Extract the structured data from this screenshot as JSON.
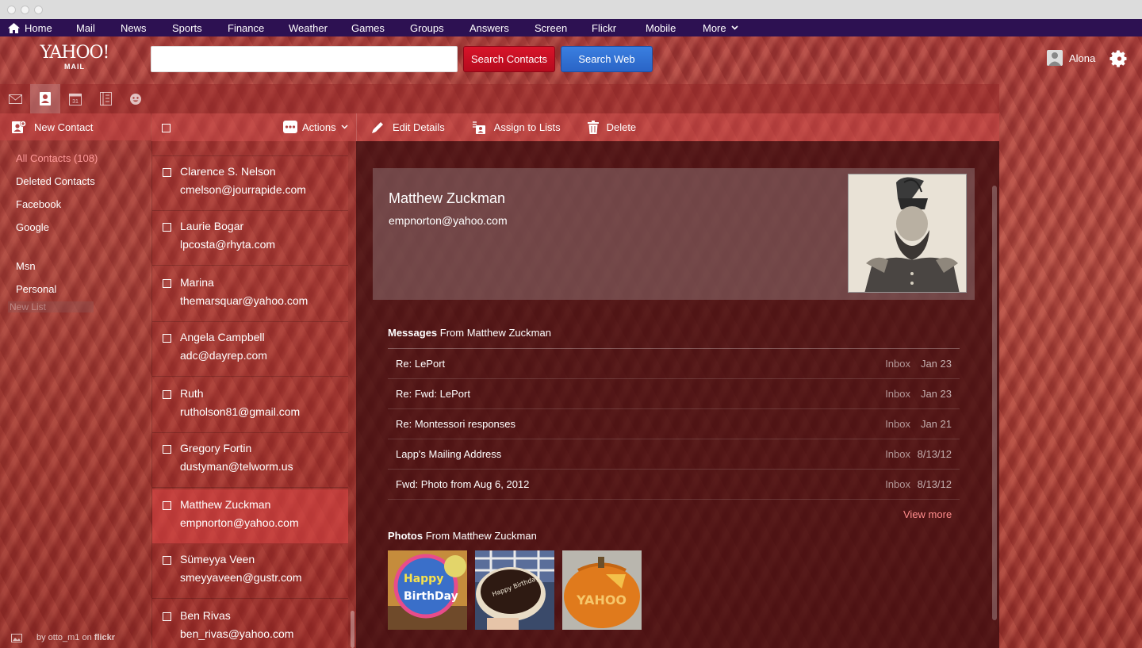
{
  "nav": {
    "items": [
      "Home",
      "Mail",
      "News",
      "Sports",
      "Finance",
      "Weather",
      "Games",
      "Groups",
      "Answers",
      "Screen",
      "Flickr",
      "Mobile",
      "More"
    ]
  },
  "header": {
    "logo": "YAHOO!",
    "logo_sub": "MAIL",
    "search_value": "",
    "search_contacts_label": "Search Contacts",
    "search_web_label": "Search Web",
    "username": "Alona"
  },
  "app_tabs": [
    "mail-icon",
    "contacts-icon",
    "calendar-icon",
    "notepad-icon",
    "messenger-icon"
  ],
  "sidebar": {
    "new_contact_label": "New Contact",
    "items": [
      {
        "label": "All Contacts (108)",
        "active": true
      },
      {
        "label": "Deleted Contacts",
        "active": false
      },
      {
        "label": "Facebook",
        "active": false
      },
      {
        "label": "Google",
        "active": false
      },
      {
        "label": "Msn",
        "active": false
      },
      {
        "label": "Personal",
        "active": false
      }
    ],
    "new_list_placeholder": "New List",
    "photo_credit": {
      "by": "by otto_m1 on",
      "site": "flickr"
    }
  },
  "listbar": {
    "actions_label": "Actions"
  },
  "detailbar": {
    "edit_label": "Edit Details",
    "assign_label": "Assign to Lists",
    "delete_label": "Delete"
  },
  "contacts": [
    {
      "name": "Clarence S. Nelson",
      "email": "cmelson@jourrapide.com",
      "selected": false
    },
    {
      "name": "Laurie Bogar",
      "email": "lpcosta@rhyta.com",
      "selected": false
    },
    {
      "name": "Marina",
      "email": "themarsquar@yahoo.com",
      "selected": false
    },
    {
      "name": "Angela Campbell",
      "email": "adc@dayrep.com",
      "selected": false
    },
    {
      "name": "Ruth",
      "email": "rutholson81@gmail.com",
      "selected": false
    },
    {
      "name": "Gregory Fortin",
      "email": "dustyman@telworm.us",
      "selected": false
    },
    {
      "name": "Matthew Zuckman",
      "email": "empnorton@yahoo.com",
      "selected": true
    },
    {
      "name": "Sümeyya Veen",
      "email": "smeyyaveen@gustr.com",
      "selected": false
    },
    {
      "name": "Ben Rivas",
      "email": "ben_rivas@yahoo.com",
      "selected": false
    }
  ],
  "detail": {
    "name": "Matthew Zuckman",
    "email": "empnorton@yahoo.com",
    "messages_heading": "Messages",
    "messages_from": "From Matthew Zuckman",
    "messages": [
      {
        "subject": "Re: LePort",
        "folder": "Inbox",
        "date": "Jan 23"
      },
      {
        "subject": "Re: Fwd: LePort",
        "folder": "Inbox",
        "date": "Jan 23"
      },
      {
        "subject": "Re: Montessori responses",
        "folder": "Inbox",
        "date": "Jan 21"
      },
      {
        "subject": "Lapp's Mailing Address",
        "folder": "Inbox",
        "date": "8/13/12"
      },
      {
        "subject": "Fwd: Photo from Aug 6, 2012",
        "folder": "Inbox",
        "date": "8/13/12"
      }
    ],
    "view_more": "View more",
    "photos_heading": "Photos",
    "photos_from": "From Matthew Zuckman",
    "photos": [
      "birthday-balloon-photo",
      "birthday-cake-photo",
      "yahoo-pumpkin-photo"
    ]
  },
  "colors": {
    "nav_bg": "#2d1152",
    "search_contacts": "#c8102e",
    "search_web": "#2f6fd6",
    "active_link": "#ff9a9a",
    "view_more": "#ff8c8c"
  }
}
